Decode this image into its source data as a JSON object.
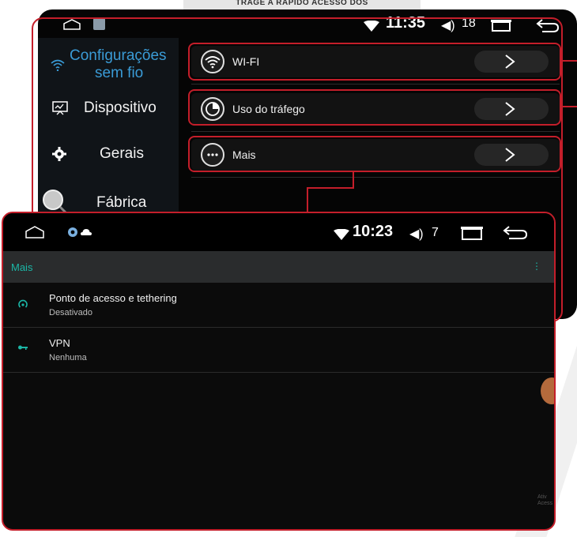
{
  "banner": {
    "text": "TRAGE A RÁPIDO ACESSO DOS"
  },
  "back_screen": {
    "status": {
      "time": "11:35",
      "volume": "18"
    },
    "sidebar": {
      "items": [
        {
          "label_line1": "Configurações",
          "label_line2": "sem fio",
          "active": true
        },
        {
          "label": "Dispositivo"
        },
        {
          "label": "Gerais"
        },
        {
          "label": "Fábrica"
        }
      ]
    },
    "menu": {
      "rows": [
        {
          "label": "WI-FI",
          "icon": "wifi-icon"
        },
        {
          "label": "Uso do tráfego",
          "icon": "data-usage-icon"
        },
        {
          "label": "Mais",
          "icon": "more-icon"
        }
      ]
    }
  },
  "front_screen": {
    "status": {
      "time": "10:23",
      "volume": "7"
    },
    "title": "Mais",
    "items": [
      {
        "title": "Ponto de acesso e tethering",
        "subtitle": "Desativado",
        "icon": "hotspot-icon"
      },
      {
        "title": "VPN",
        "subtitle": "Nenhuma",
        "icon": "key-icon"
      }
    ],
    "watermark_line1": "Ativ",
    "watermark_line2": "Acess"
  },
  "colors": {
    "accent_red": "#c41e2a",
    "sidebar_active": "#3a9bd6",
    "teal": "#1bb6a6"
  }
}
